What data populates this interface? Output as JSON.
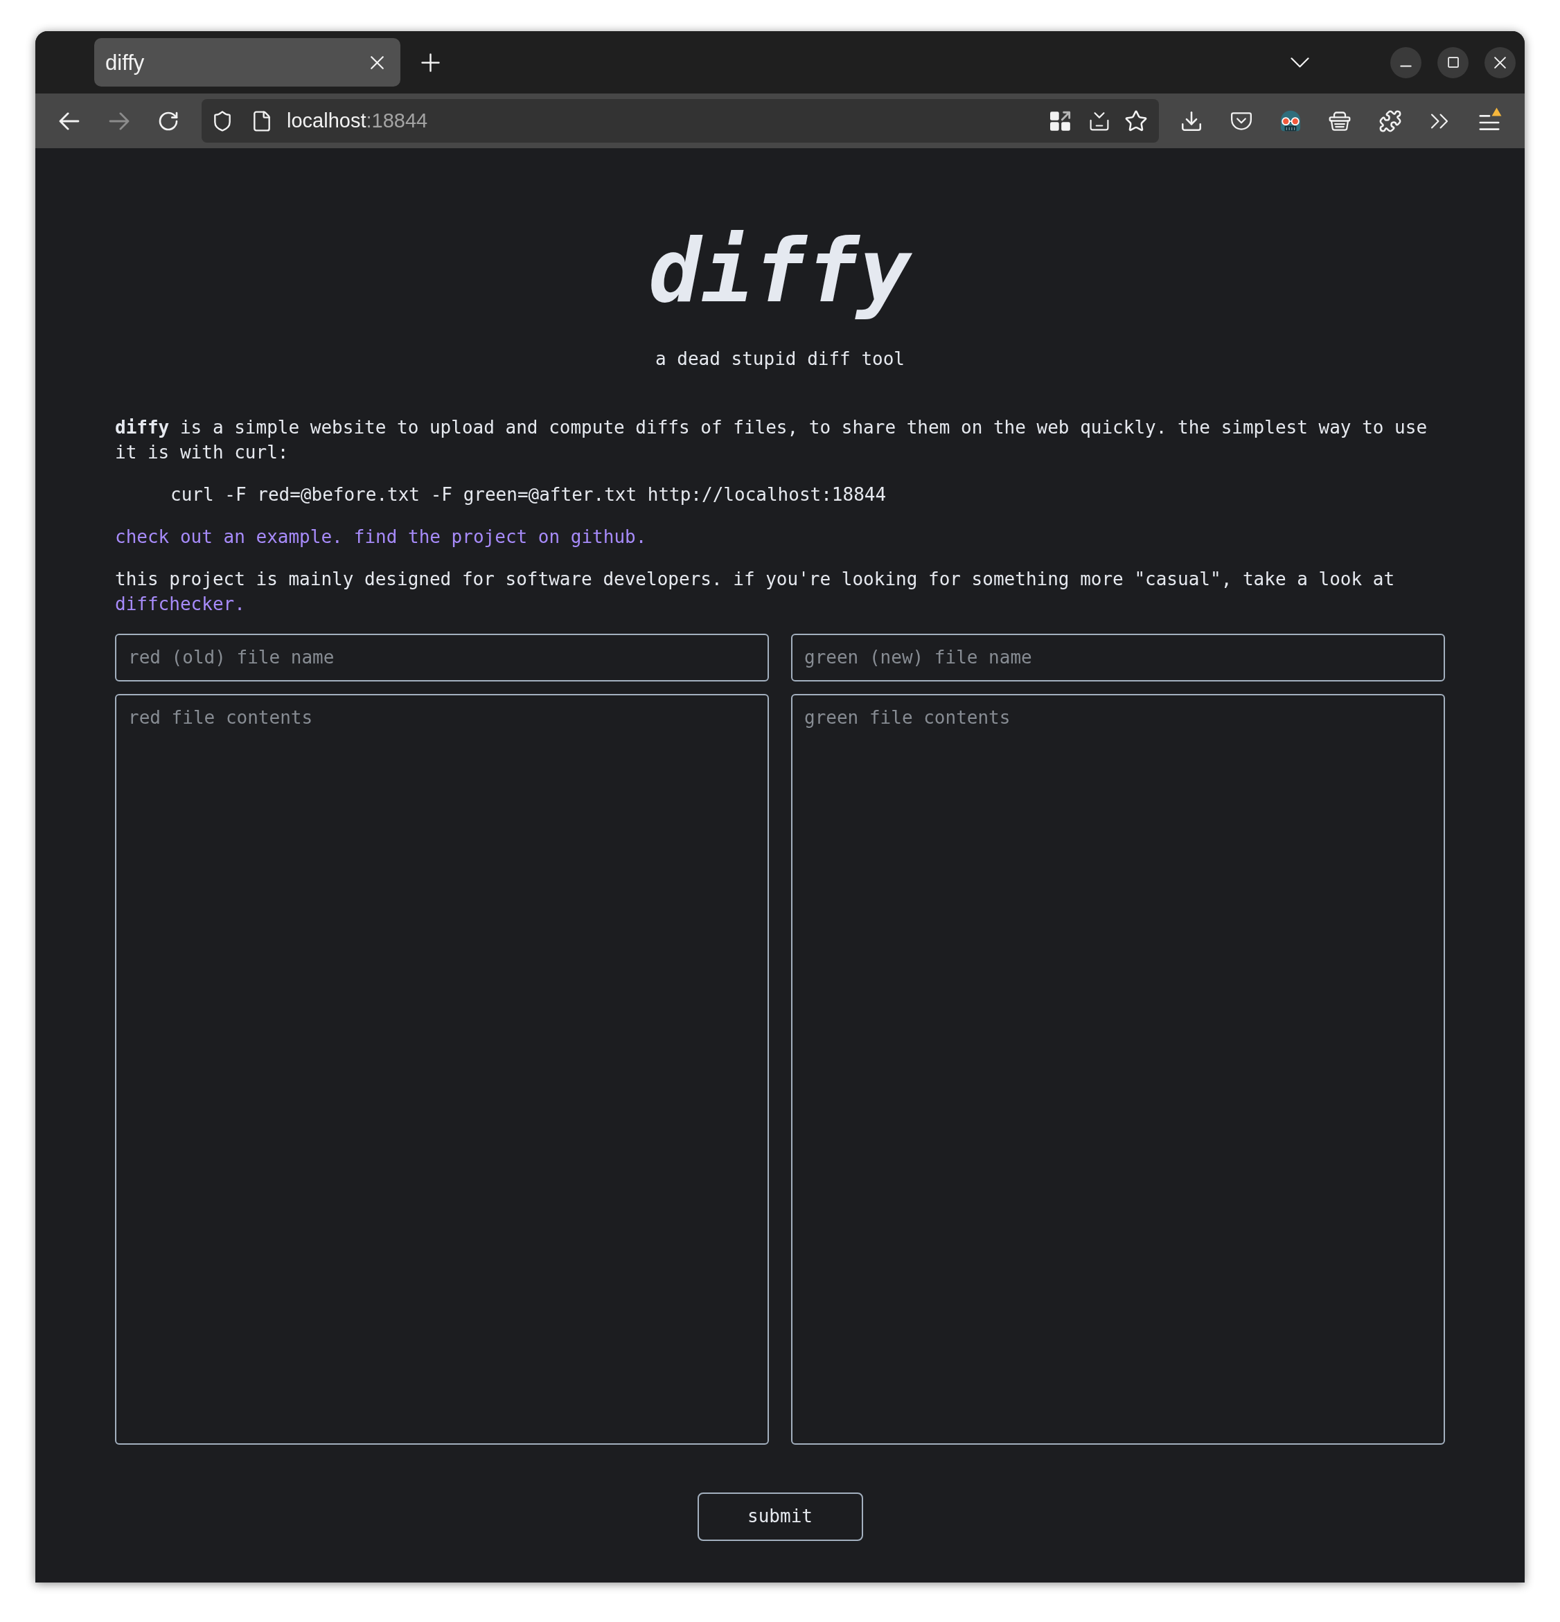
{
  "browser": {
    "tab": {
      "title": "diffy",
      "selected": true
    },
    "navigation": {
      "back_disabled": false,
      "forward_disabled": true
    },
    "address_bar": {
      "host": "localhost",
      "port": ":18844"
    },
    "menu": {
      "update_badge": true
    }
  },
  "page": {
    "title": "diffy",
    "subtitle": "a dead stupid diff tool",
    "intro": "**diffy** is a simple website to upload and compute diffs of files, to share them on the web quickly. the simplest way to use it is with curl:",
    "command": "curl -F red=@before.txt -F green=@after.txt http://localhost:18844",
    "links": [
      "check out an example.",
      "find the project on github."
    ],
    "note": {
      "text": "this project is mainly designed for software developers. if you're looking for something more \"casual\", take a look at",
      "link": "diffchecker."
    },
    "form": {
      "file_names": [
        {
          "placeholder": "red (old) file name"
        },
        {
          "placeholder": "green (new) file name"
        }
      ],
      "contents": [
        {
          "placeholder": "red file contents"
        },
        {
          "placeholder": "green file contents"
        }
      ],
      "submit": "submit"
    }
  }
}
